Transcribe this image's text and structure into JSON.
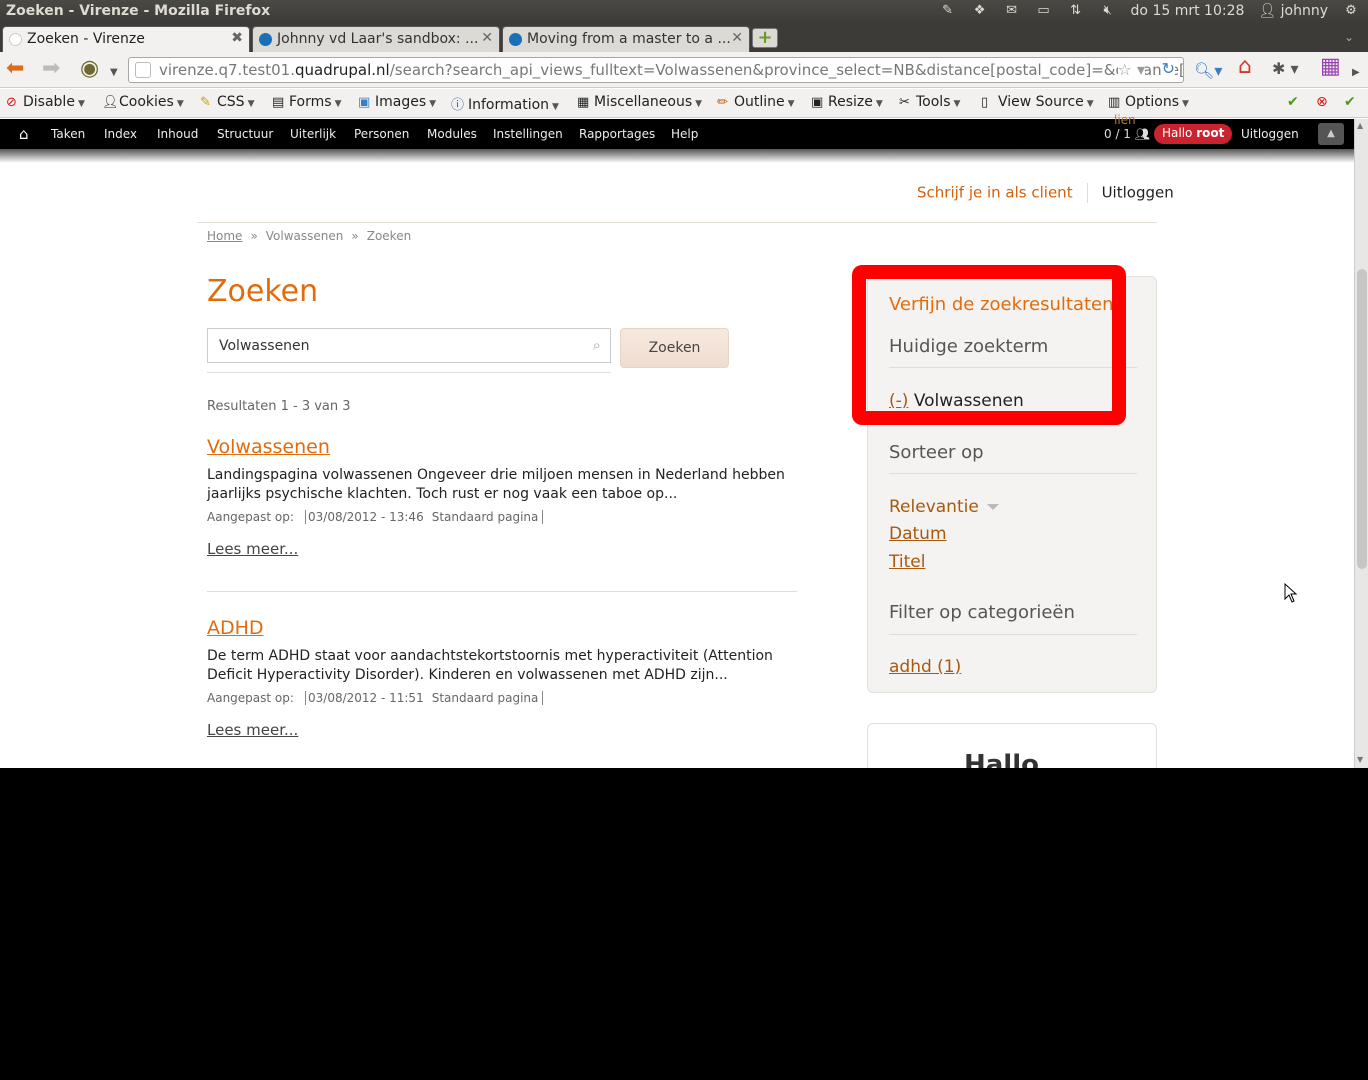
{
  "os": {
    "window_title": "Zoeken - Virenze - Mozilla Firefox",
    "clock": "do 15 mrt 10:28",
    "user": "johnny"
  },
  "browser": {
    "tabs": [
      {
        "label": "Zoeken - Virenze"
      },
      {
        "label": "Johnny vd Laar's sandbox: ..."
      },
      {
        "label": "Moving from a master to a ..."
      }
    ],
    "url_prefix": "virenze.q7.test01.",
    "url_domain": "quadrupal.nl",
    "url_rest": "/search?search_api_views_fulltext=Volwassenen&province_select=NB&distance[postal_code]=&distance[search_",
    "devtoolbar": [
      "Disable",
      "Cookies",
      "CSS",
      "Forms",
      "Images",
      "Information",
      "Miscellaneous",
      "Outline",
      "Resize",
      "Tools",
      "View Source",
      "Options"
    ]
  },
  "admin": {
    "items": [
      "Taken",
      "Index",
      "Inhoud",
      "Structuur",
      "Uiterlijk",
      "Personen",
      "Modules",
      "Instellingen",
      "Rapportages",
      "Help"
    ],
    "counter": "0 / 1",
    "lien": "lien",
    "hello_prefix": "Hallo",
    "hello_user": "root",
    "logout": "Uitloggen"
  },
  "page": {
    "toplinks": {
      "client": "Schrijf je in als client",
      "logout": "Uitloggen"
    },
    "breadcrumb": {
      "home": "Home",
      "section": "Volwassenen",
      "current": "Zoeken",
      "separator": "»"
    },
    "title": "Zoeken",
    "search": {
      "value": "Volwassenen",
      "button": "Zoeken"
    },
    "result_count": "Resultaten 1 - 3 van 3",
    "results": [
      {
        "title": "Volwassenen",
        "snippet": "Landingspagina volwassenen Ongeveer drie miljoen mensen in Nederland hebben jaarlijks psychische klachten. Toch rust er nog vaak een taboe op...",
        "meta_label": "Aangepast op:",
        "date": "03/08/2012 - 13:46",
        "type": "Standaard pagina",
        "more": "Lees meer..."
      },
      {
        "title": "ADHD",
        "snippet": "De term ADHD staat voor aandachtstekortstoornis met hyperactiviteit (Attention Deficit Hyperactivity Disorder). Kinderen en volwassenen met ADHD zijn...",
        "meta_label": "Aangepast op:",
        "date": "03/08/2012 - 11:51",
        "type": "Standaard pagina",
        "more": "Lees meer..."
      }
    ],
    "sidebar": {
      "title": "Verfijn de zoekresultaten",
      "current_term_heading": "Huidige zoekterm",
      "remove": "(-)",
      "term": "Volwassenen",
      "sort_heading": "Sorteer op",
      "sort_options": [
        "Relevantie",
        "Datum",
        "Titel"
      ],
      "filter_heading": "Filter op categorieën",
      "filters": [
        "adhd (1)"
      ]
    },
    "hallo_box": "Hallo"
  }
}
